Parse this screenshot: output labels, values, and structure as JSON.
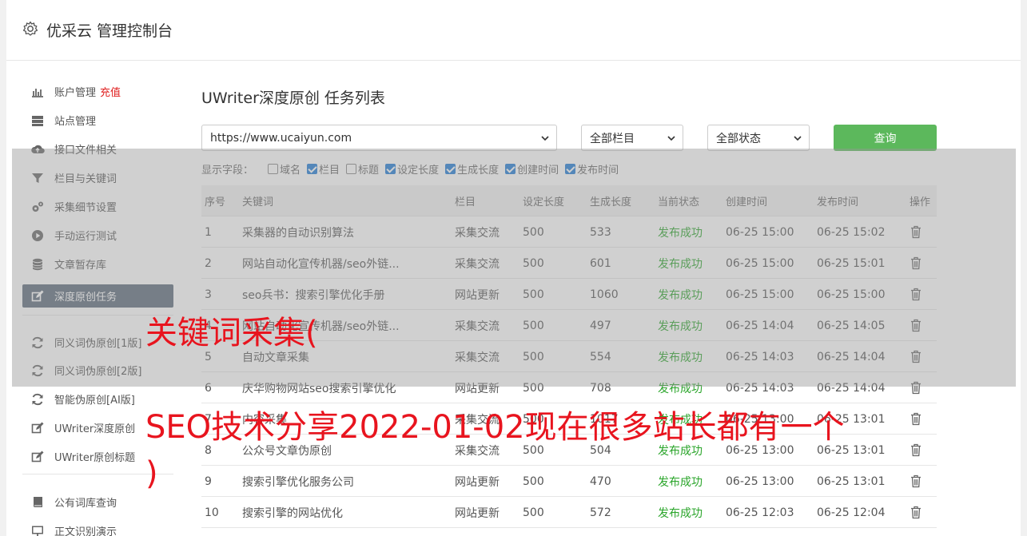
{
  "header": {
    "title": "优采云 管理控制台"
  },
  "sidebar": {
    "items": [
      {
        "label": "账户管理",
        "extra": "充值",
        "icon": "bar-chart-icon"
      },
      {
        "label": "站点管理",
        "icon": "server-icon"
      },
      {
        "label": "接口文件相关",
        "icon": "cloud-upload-icon"
      },
      {
        "label": "栏目与关键词",
        "icon": "filter-icon"
      },
      {
        "label": "采集细节设置",
        "icon": "gears-icon"
      },
      {
        "label": "手动运行测试",
        "icon": "play-circle-icon"
      },
      {
        "label": "文章暂存库",
        "icon": "database-icon"
      },
      {
        "label": "深度原创任务",
        "icon": "edit-icon",
        "active": true
      },
      {
        "label": "同义词伪原创[1版]",
        "icon": "refresh-icon"
      },
      {
        "label": "同义词伪原创[2版]",
        "icon": "refresh-icon"
      },
      {
        "label": "智能伪原创[AI版]",
        "icon": "refresh-icon"
      },
      {
        "label": "UWriter深度原创",
        "icon": "edit-icon"
      },
      {
        "label": "UWriter原创标题",
        "icon": "edit-icon"
      },
      {
        "label": "公有词库查询",
        "icon": "book-icon"
      },
      {
        "label": "正文识别演示",
        "icon": "monitor-icon"
      }
    ]
  },
  "main": {
    "title": "UWriter深度原创 任务列表",
    "filters": {
      "site": "https://www.ucaiyun.com",
      "column": "全部栏目",
      "status": "全部状态",
      "query_label": "查询"
    },
    "fields_label": "显示字段：",
    "fields": [
      {
        "label": "域名",
        "checked": false
      },
      {
        "label": "栏目",
        "checked": true
      },
      {
        "label": "标题",
        "checked": false
      },
      {
        "label": "设定长度",
        "checked": true
      },
      {
        "label": "生成长度",
        "checked": true
      },
      {
        "label": "创建时间",
        "checked": true
      },
      {
        "label": "发布时间",
        "checked": true
      }
    ],
    "table": {
      "headers": [
        "序号",
        "关键词",
        "栏目",
        "设定长度",
        "生成长度",
        "当前状态",
        "创建时间",
        "发布时间",
        "操作"
      ],
      "rows": [
        [
          "1",
          "采集器的自动识别算法",
          "采集交流",
          "500",
          "533",
          "发布成功",
          "06-25 15:00",
          "06-25 15:02"
        ],
        [
          "2",
          "网站自动化宣传机器/seo外链...",
          "采集交流",
          "500",
          "601",
          "发布成功",
          "06-25 15:00",
          "06-25 15:01"
        ],
        [
          "3",
          "seo兵书：搜索引擎优化手册",
          "网站更新",
          "500",
          "1060",
          "发布成功",
          "06-25 15:00",
          "06-25 15:00"
        ],
        [
          "4",
          "网站自动化宣传机器/seo外链...",
          "采集交流",
          "500",
          "497",
          "发布成功",
          "06-25 14:04",
          "06-25 14:05"
        ],
        [
          "5",
          "自动文章采集",
          "采集交流",
          "500",
          "554",
          "发布成功",
          "06-25 14:03",
          "06-25 14:04"
        ],
        [
          "6",
          "庆华购物网站seo搜索引擎优化",
          "网站更新",
          "500",
          "708",
          "发布成功",
          "06-25 14:03",
          "06-25 14:04"
        ],
        [
          "7",
          "内容采集",
          "采集交流",
          "500",
          "1017",
          "发布成功",
          "06-25 13:00",
          "06-25 13:01"
        ],
        [
          "8",
          "公众号文章伪原创",
          "采集交流",
          "500",
          "504",
          "发布成功",
          "06-25 13:00",
          "06-25 13:01"
        ],
        [
          "9",
          "搜索引擎优化服务公司",
          "网站更新",
          "500",
          "470",
          "发布成功",
          "06-25 13:00",
          "06-25 13:01"
        ],
        [
          "10",
          "搜索引擎的网站优化",
          "网站更新",
          "500",
          "572",
          "发布成功",
          "06-25 12:03",
          "06-25 12:04"
        ]
      ]
    }
  },
  "overlay": {
    "line1": "关键词采集(",
    "line2": "SEO技术分享2022-01-02现在很多站长都有一个",
    "line3": ")"
  },
  "colors": {
    "accent": "#5cb85c",
    "active_menu": "#5c6a7a",
    "status_ok": "#2aa52a",
    "caption": "#e8141e",
    "recharge": "#e02020"
  }
}
